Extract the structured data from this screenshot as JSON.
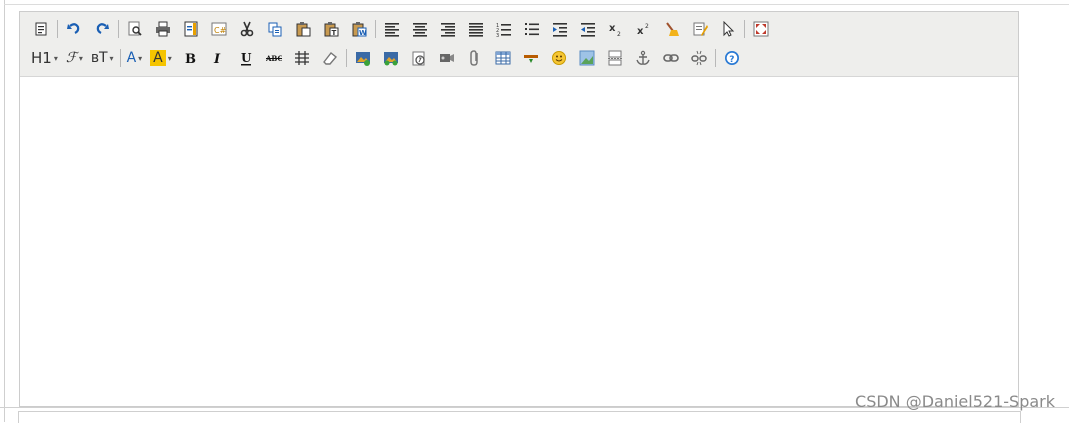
{
  "toolbar": {
    "row1": [
      {
        "name": "source-code-icon"
      },
      "sep",
      {
        "name": "undo-icon"
      },
      {
        "name": "redo-icon"
      },
      "sep",
      {
        "name": "preview-icon"
      },
      {
        "name": "print-icon"
      },
      {
        "name": "template-icon"
      },
      {
        "name": "code-snippet-icon"
      },
      {
        "name": "cut-icon"
      },
      {
        "name": "copy-icon"
      },
      {
        "name": "paste-icon"
      },
      {
        "name": "paste-plain-text-icon"
      },
      {
        "name": "paste-from-word-icon"
      },
      "sep",
      {
        "name": "align-left-icon"
      },
      {
        "name": "align-center-icon"
      },
      {
        "name": "align-right-icon"
      },
      {
        "name": "align-justify-icon"
      },
      {
        "name": "ordered-list-icon"
      },
      {
        "name": "unordered-list-icon"
      },
      {
        "name": "indent-icon"
      },
      {
        "name": "outdent-icon"
      },
      {
        "name": "subscript-icon"
      },
      {
        "name": "superscript-icon"
      },
      {
        "name": "clear-format-icon"
      },
      {
        "name": "quick-format-icon"
      },
      {
        "name": "select-all-icon"
      },
      "sep",
      {
        "name": "fullscreen-icon"
      }
    ],
    "row2": [
      {
        "name": "heading-button",
        "text": "H1"
      },
      {
        "name": "font-family-button",
        "text": "ℱ"
      },
      {
        "name": "font-size-button",
        "text": "ʙT"
      },
      "sep",
      {
        "name": "font-color-button",
        "text": "A"
      },
      {
        "name": "highlight-color-button",
        "text": "A"
      },
      {
        "name": "bold-icon"
      },
      {
        "name": "italic-icon"
      },
      {
        "name": "underline-icon"
      },
      {
        "name": "strikethrough-icon"
      },
      {
        "name": "line-height-icon"
      },
      {
        "name": "eraser-icon"
      },
      "sep",
      {
        "name": "image-icon"
      },
      {
        "name": "multi-image-icon"
      },
      {
        "name": "flash-icon"
      },
      {
        "name": "media-icon"
      },
      {
        "name": "attachment-icon"
      },
      {
        "name": "table-icon"
      },
      {
        "name": "horizontal-rule-icon"
      },
      {
        "name": "emoticon-icon"
      },
      {
        "name": "baidu-map-icon"
      },
      {
        "name": "page-break-icon"
      },
      {
        "name": "anchor-icon"
      },
      {
        "name": "link-icon"
      },
      {
        "name": "unlink-icon"
      },
      "sep",
      {
        "name": "help-icon"
      }
    ]
  },
  "watermark": "CSDN @Daniel521-Spark",
  "colors": {
    "toolbar_bg": "#eeeeec",
    "icon_blue": "#1a5fb4",
    "icon_dark": "#333333",
    "highlight_yellow": "#f5c400"
  }
}
